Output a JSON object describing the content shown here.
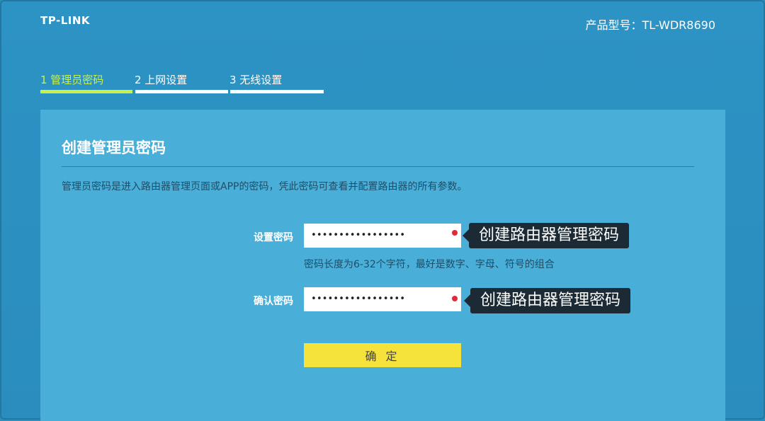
{
  "header": {
    "logo_text": "TP-LINK",
    "model_label": "产品型号：TL-WDR8690"
  },
  "steps": [
    {
      "label": "1 管理员密码",
      "active": true
    },
    {
      "label": "2 上网设置",
      "active": false
    },
    {
      "label": "3 无线设置",
      "active": false
    }
  ],
  "panel": {
    "title": "创建管理员密码",
    "description": "管理员密码是进入路由器管理页面或APP的密码，凭此密码可查看并配置路由器的所有参数。",
    "fields": [
      {
        "label": "设置密码",
        "value": "•••••••••••••••••",
        "tooltip": "创建路由器管理密码",
        "hint": "密码长度为6-32个字符，最好是数字、字母、符号的组合"
      },
      {
        "label": "确认密码",
        "value": "•••••••••••••••••",
        "tooltip": "创建路由器管理密码"
      }
    ],
    "confirm_label": "确 定"
  },
  "colors": {
    "background": "#2a8fbf",
    "panel": "#49afd9",
    "active_step": "#c9f04a",
    "confirm_button": "#f5e23b",
    "required_dot": "#e0293a",
    "tooltip_bg": "#1b2a34"
  },
  "icons": {
    "required": "required-dot-icon"
  }
}
